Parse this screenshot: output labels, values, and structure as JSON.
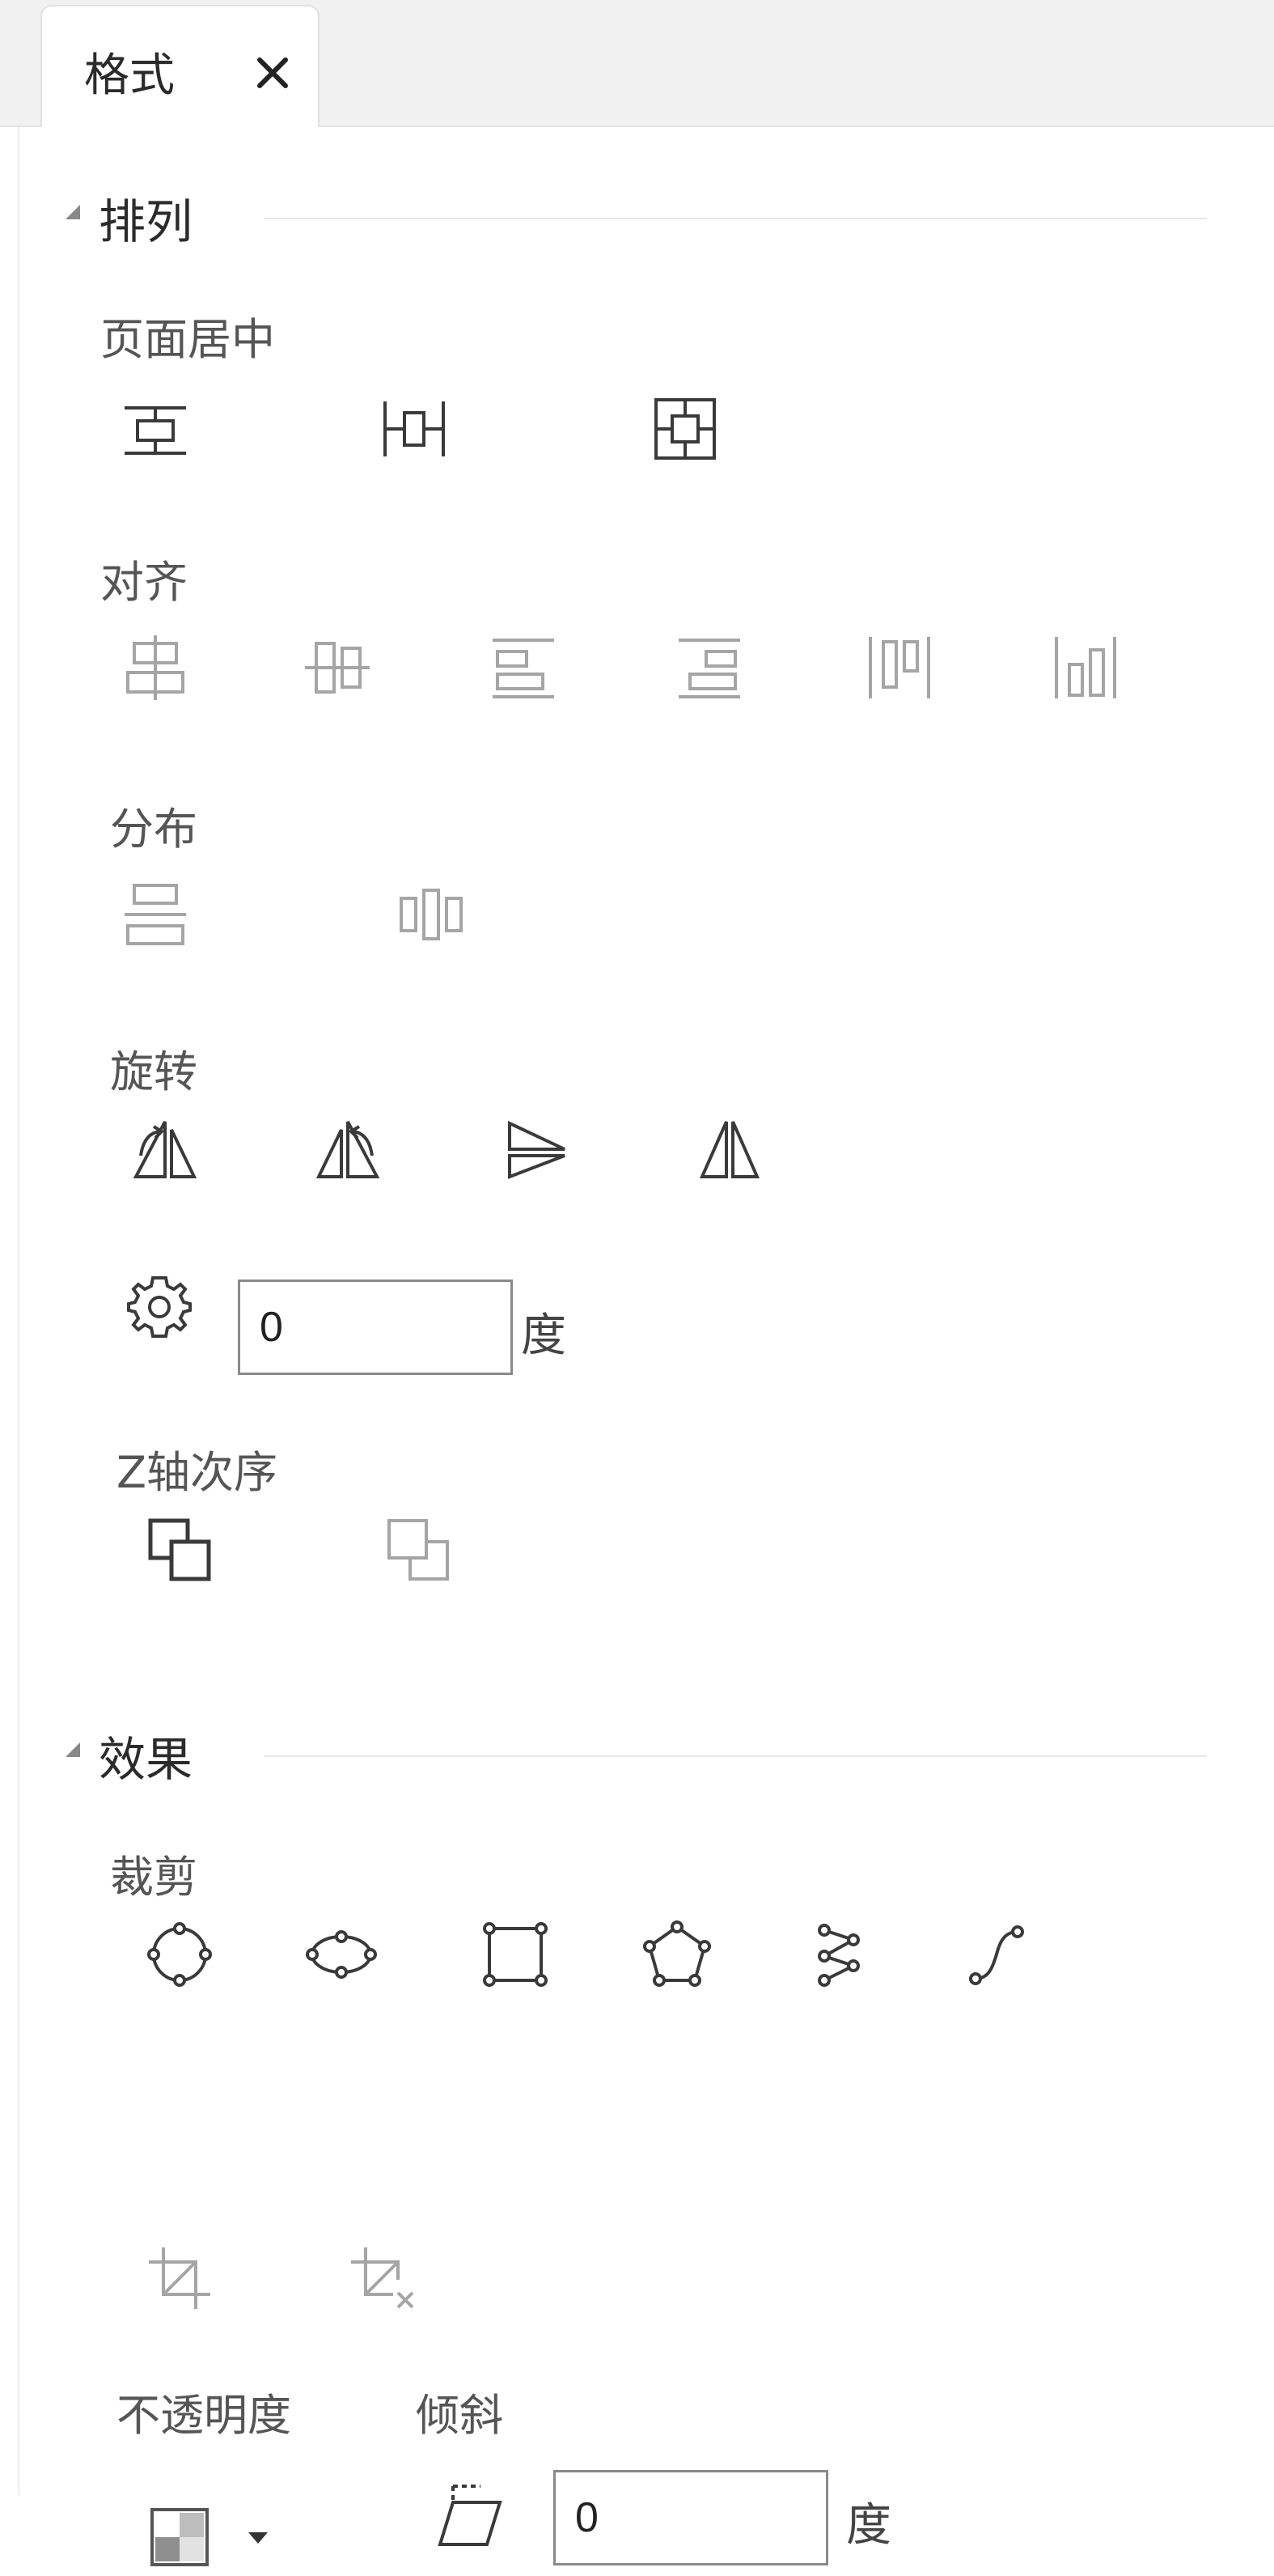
{
  "tab": {
    "label": "格式"
  },
  "sections": {
    "arrange": {
      "title": "排列",
      "page_center": {
        "label": "页面居中"
      },
      "align": {
        "label": "对齐"
      },
      "distribute": {
        "label": "分布"
      },
      "rotate": {
        "label": "旋转",
        "angle_value": "0",
        "unit": "度"
      },
      "z_order": {
        "label": "Z轴次序"
      }
    },
    "effects": {
      "title": "效果",
      "crop": {
        "label": "裁剪"
      },
      "opacity": {
        "label": "不透明度"
      },
      "skew": {
        "label": "倾斜",
        "value": "0",
        "unit": "度"
      }
    }
  },
  "colors": {
    "icon_active": "#3a3a3a",
    "icon_disabled": "#b5b5b5",
    "tab_bar": "#f1f1f1",
    "divider": "#e8e8e8"
  },
  "icons": [
    "close-icon",
    "collapse-triangle-icon",
    "center-horizontal-icon",
    "center-vertical-icon",
    "center-page-icon",
    "align-center-horizontal-icon",
    "align-center-vertical-icon",
    "align-left-icon",
    "align-right-icon",
    "align-top-icon",
    "align-bottom-icon",
    "distribute-vertical-icon",
    "distribute-horizontal-icon",
    "rotate-left-icon",
    "rotate-right-icon",
    "flip-vertical-icon",
    "flip-horizontal-icon",
    "rotate-settings-icon",
    "bring-to-front-icon",
    "send-to-back-icon",
    "crop-circle-icon",
    "crop-ellipse-icon",
    "crop-rectangle-icon",
    "crop-pentagon-icon",
    "crop-polyline-icon",
    "crop-curve-icon",
    "crop-icon",
    "clear-crop-icon",
    "opacity-icon",
    "dropdown-arrow-icon",
    "skew-icon"
  ]
}
